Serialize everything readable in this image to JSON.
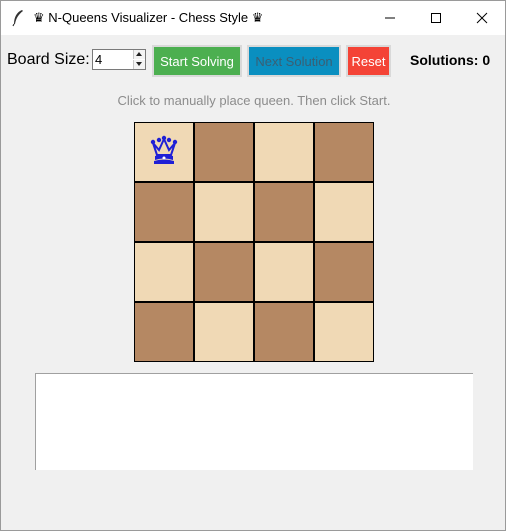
{
  "window": {
    "title": "♛ N-Queens Visualizer - Chess Style ♛",
    "icons": [
      "feather-icon",
      "minimize-icon",
      "maximize-icon",
      "close-icon"
    ]
  },
  "toolbar": {
    "board_size_label": "Board Size:",
    "board_size_value": "4",
    "start_label": "Start Solving",
    "next_label": "Next Solution",
    "reset_label": "Reset",
    "solutions_text": "Solutions: 0"
  },
  "hint": "Click to manually place queen. Then click Start.",
  "board": {
    "size": 4,
    "queen_cell": [
      0,
      0
    ],
    "queen_glyph": "♛",
    "colors": {
      "light": "#f0d9b5",
      "dark": "#b58863",
      "queen": "#1f1fd6"
    }
  },
  "output": {
    "text": ""
  },
  "colors": {
    "start": "#4caf50",
    "next": "#0a8fc0",
    "reset": "#f44336"
  }
}
